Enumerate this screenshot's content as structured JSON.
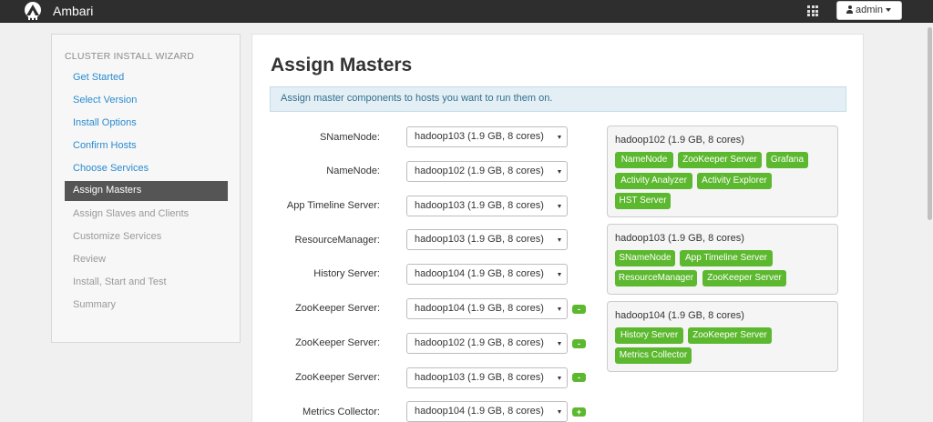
{
  "topbar": {
    "brand": "Ambari",
    "user_label": "admin",
    "logo_icon": "ambari-logo-icon",
    "apps_icon": "grid-icon"
  },
  "wizard": {
    "title": "CLUSTER INSTALL WIZARD",
    "steps": [
      {
        "label": "Get Started",
        "state": "done"
      },
      {
        "label": "Select Version",
        "state": "done"
      },
      {
        "label": "Install Options",
        "state": "done"
      },
      {
        "label": "Confirm Hosts",
        "state": "done"
      },
      {
        "label": "Choose Services",
        "state": "done"
      },
      {
        "label": "Assign Masters",
        "state": "active"
      },
      {
        "label": "Assign Slaves and Clients",
        "state": "pending"
      },
      {
        "label": "Customize Services",
        "state": "pending"
      },
      {
        "label": "Review",
        "state": "pending"
      },
      {
        "label": "Install, Start and Test",
        "state": "pending"
      },
      {
        "label": "Summary",
        "state": "pending"
      }
    ]
  },
  "main": {
    "title": "Assign Masters",
    "info": "Assign master components to hosts you want to run them on.",
    "assignments": [
      {
        "label": "SNameNode:",
        "host": "hadoop103 (1.9 GB, 8 cores)",
        "action": ""
      },
      {
        "label": "NameNode:",
        "host": "hadoop102 (1.9 GB, 8 cores)",
        "action": ""
      },
      {
        "label": "App Timeline Server:",
        "host": "hadoop103 (1.9 GB, 8 cores)",
        "action": ""
      },
      {
        "label": "ResourceManager:",
        "host": "hadoop103 (1.9 GB, 8 cores)",
        "action": ""
      },
      {
        "label": "History Server:",
        "host": "hadoop104 (1.9 GB, 8 cores)",
        "action": ""
      },
      {
        "label": "ZooKeeper Server:",
        "host": "hadoop104 (1.9 GB, 8 cores)",
        "action": "-"
      },
      {
        "label": "ZooKeeper Server:",
        "host": "hadoop102 (1.9 GB, 8 cores)",
        "action": "-"
      },
      {
        "label": "ZooKeeper Server:",
        "host": "hadoop103 (1.9 GB, 8 cores)",
        "action": "-"
      },
      {
        "label": "Metrics Collector:",
        "host": "hadoop104 (1.9 GB, 8 cores)",
        "action": "+"
      }
    ],
    "hosts": [
      {
        "name": "hadoop102 (1.9 GB, 8 cores)",
        "components": [
          "NameNode",
          "ZooKeeper Server",
          "Grafana",
          "Activity Analyzer",
          "Activity Explorer",
          "HST Server"
        ]
      },
      {
        "name": "hadoop103 (1.9 GB, 8 cores)",
        "components": [
          "SNameNode",
          "App Timeline Server",
          "ResourceManager",
          "ZooKeeper Server"
        ]
      },
      {
        "name": "hadoop104 (1.9 GB, 8 cores)",
        "components": [
          "History Server",
          "ZooKeeper Server",
          "Metrics Collector"
        ]
      }
    ]
  },
  "colors": {
    "topbar": "#2e2e2e",
    "link": "#2a8bd0",
    "active_step": "#555555",
    "badge": "#5cb82e",
    "info_bg": "#e4eff5"
  }
}
